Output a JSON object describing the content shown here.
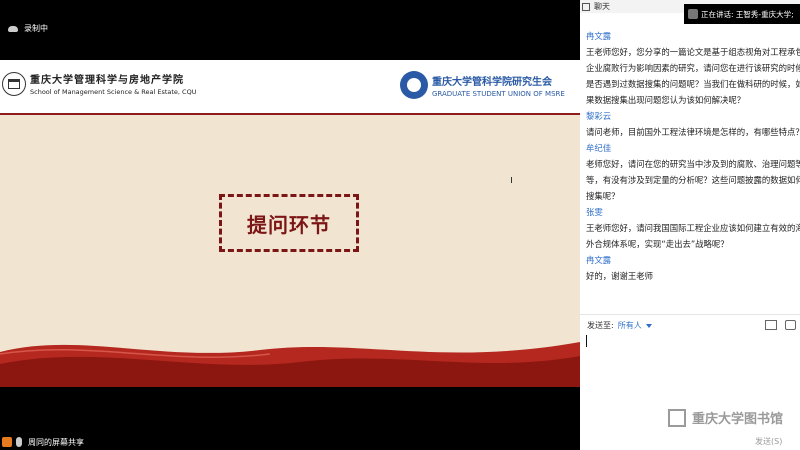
{
  "meeting": {
    "recording_label": "录制中",
    "screen_share_label": "周同的屏幕共享"
  },
  "slide": {
    "left_logo_cn": "重庆大学管理科学与房地产学院",
    "left_logo_en": "School of Management Science & Real Estate, CQU",
    "right_logo_cn": "重庆大学管科学院研究生会",
    "right_logo_en": "GRADUATE STUDENT UNION OF MSRE",
    "title": "提问环节"
  },
  "chat": {
    "header": "聊天",
    "speaking": "正在讲话: 王智秀-重庆大学;",
    "messages": [
      {
        "name": "冉文露",
        "lines": [
          "王老师您好，您分享的一篇论文是基于组态视角对工程承包",
          "企业腐败行为影响因素的研究，请问您在进行该研究的时候",
          "是否遇到过数据搜集的问题呢？当我们在做科研的时候，如",
          "果数据搜集出现问题您认为该如何解决呢？"
        ]
      },
      {
        "name": "黎彩云",
        "lines": [
          "请问老师，目前国外工程法律环境是怎样的，有哪些特点？"
        ]
      },
      {
        "name": "牟纪佳",
        "lines": [
          "老师您好，请问在您的研究当中涉及到的腐败、治理问题等",
          "等，有没有涉及到定量的分析呢？这些问题披露的数据如何",
          "搜集呢？"
        ]
      },
      {
        "name": "张雯",
        "lines": [
          "王老师您好，请问我国国际工程企业应该如何建立有效的海",
          "外合规体系呢，实现“走出去”战略呢？"
        ]
      },
      {
        "name": "冉文露",
        "lines": [
          "好的，谢谢王老师"
        ]
      }
    ],
    "send_to_label": "发送至:",
    "send_to_value": "所有人",
    "send_button": "发送(S)",
    "watermark": "重庆大学图书馆"
  }
}
